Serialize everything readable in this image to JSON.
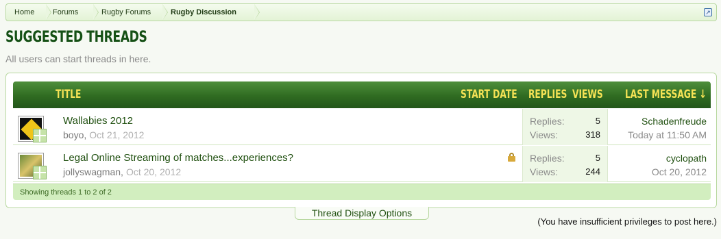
{
  "breadcrumb": {
    "items": [
      "Home",
      "Forums",
      "Rugby Forums",
      "Rugby Discussion"
    ]
  },
  "page": {
    "title": "Suggested Threads",
    "description": "All users can start threads in here."
  },
  "table": {
    "headers": {
      "title": "Title",
      "start_date": "Start Date",
      "replies": "Replies",
      "views": "Views",
      "last_message": "Last Message ↓"
    },
    "rows": [
      {
        "title": "Wallabies 2012",
        "author": "boyo,",
        "date": "Oct 21, 2012",
        "locked": false,
        "replies_label": "Replies:",
        "replies": "5",
        "views_label": "Views:",
        "views": "318",
        "last_user": "Schadenfreude",
        "last_time": "Today at 11:50 AM"
      },
      {
        "title": "Legal Online Streaming of matches...experiences?",
        "author": "jollyswagman,",
        "date": "Oct 20, 2012",
        "locked": true,
        "replies_label": "Replies:",
        "replies": "5",
        "views_label": "Views:",
        "views": "244",
        "last_user": "cyclopath",
        "last_time": "Oct 20, 2012"
      }
    ],
    "footer": "Showing threads 1 to 2 of 2"
  },
  "display_options": "Thread Display Options",
  "privileges_note": "(You have insufficient privileges to post here.)",
  "colors": {
    "header_green": "#2f6b21",
    "header_text": "#f5e255",
    "title_green": "#155015"
  }
}
